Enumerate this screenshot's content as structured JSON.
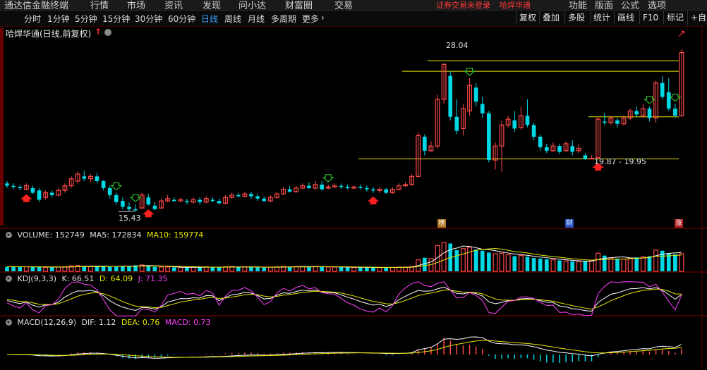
{
  "menu": {
    "app_title": "通达信金融终端",
    "items": [
      "行情",
      "市场",
      "资讯",
      "发现",
      "问小达",
      "财富圈",
      "交易"
    ],
    "warning": "证券交易未登录",
    "stock_link": "哈焊华通",
    "right_items": [
      "功能",
      "版面",
      "公式",
      "选项"
    ]
  },
  "toolbar": {
    "periods": [
      "分时",
      "1分钟",
      "5分钟",
      "15分钟",
      "30分钟",
      "60分钟",
      "日线",
      "周线",
      "月线",
      "多周期",
      "更多"
    ],
    "active_period": "日线",
    "right_buttons": [
      "复权",
      "叠加",
      "多股",
      "统计",
      "画线",
      "F10",
      "标记",
      "+自选"
    ]
  },
  "chart_header": {
    "title": "哈焊华通(日线,前复权)"
  },
  "annotations": {
    "high_label": "28.04",
    "low_label": "15.43",
    "range_label": "19.87 - 19.95"
  },
  "badges": {
    "bang": "榜",
    "cai": "财",
    "zhang": "涨"
  },
  "volume_header": {
    "label": "VOLUME: 152749",
    "ma5": "MA5: 172834",
    "ma10": "MA10: 159774"
  },
  "kdj_header": {
    "label": "KDJ(9,3,3)",
    "k": "K: 66.51",
    "d": "D: 64.09",
    "j": "J: 71.35"
  },
  "macd_header": {
    "label": "MACD(12,26,9)",
    "dif": "DIF: 1.12",
    "dea": "DEA: 0.76",
    "macd": "MACD: 0.73"
  },
  "colors": {
    "up": "#ff4a4a",
    "down": "#00d8e6",
    "ma_white": "#ffffff",
    "ma_yellow": "#e8e800",
    "kdj_j": "#ff40ff",
    "line_yellow": "#e6e600"
  },
  "chart_data": {
    "type": "candlestick",
    "price_range": [
      14.8,
      30.0
    ],
    "candles": [
      [
        17.8,
        17.6,
        18.0,
        17.4
      ],
      [
        17.6,
        17.5,
        17.8,
        17.3
      ],
      [
        17.5,
        17.4,
        17.7,
        17.2
      ],
      [
        17.3,
        17.6,
        17.8,
        17.2
      ],
      [
        17.4,
        17.0,
        17.6,
        16.9
      ],
      [
        17.2,
        16.4,
        17.4,
        16.2
      ],
      [
        16.6,
        17.0,
        17.2,
        16.4
      ],
      [
        17.0,
        16.8,
        17.2,
        16.6
      ],
      [
        16.8,
        17.2,
        17.4,
        16.7
      ],
      [
        17.2,
        17.6,
        17.8,
        17.0
      ],
      [
        17.6,
        18.2,
        18.4,
        17.4
      ],
      [
        18.0,
        18.6,
        18.8,
        17.8
      ],
      [
        18.4,
        18.2,
        18.9,
        18.0
      ],
      [
        18.2,
        18.4,
        18.6,
        17.9
      ],
      [
        18.4,
        18.0,
        18.7,
        17.8
      ],
      [
        18.0,
        17.4,
        18.1,
        17.2
      ],
      [
        17.4,
        16.8,
        17.6,
        16.5
      ],
      [
        16.8,
        16.2,
        17.0,
        16.0
      ],
      [
        16.3,
        15.8,
        16.6,
        15.6
      ],
      [
        15.8,
        15.6,
        16.2,
        15.4
      ],
      [
        15.6,
        15.5,
        16.0,
        15.43
      ],
      [
        15.7,
        16.8,
        17.0,
        15.6
      ],
      [
        16.6,
        16.0,
        16.9,
        15.9
      ],
      [
        15.9,
        15.6,
        16.2,
        15.5
      ],
      [
        15.7,
        16.3,
        16.5,
        15.6
      ],
      [
        16.3,
        16.5,
        16.8,
        16.2
      ],
      [
        16.4,
        16.3,
        16.6,
        16.2
      ],
      [
        16.3,
        16.4,
        16.6,
        16.2
      ],
      [
        16.3,
        16.2,
        16.5,
        16.0
      ],
      [
        16.2,
        16.4,
        16.6,
        16.1
      ],
      [
        16.4,
        16.2,
        16.6,
        16.0
      ],
      [
        16.2,
        16.5,
        16.7,
        16.1
      ],
      [
        16.4,
        16.3,
        16.6,
        16.2
      ],
      [
        16.3,
        16.1,
        16.5,
        16.0
      ],
      [
        16.1,
        16.6,
        16.8,
        16.0
      ],
      [
        16.6,
        16.8,
        17.0,
        16.5
      ],
      [
        16.8,
        16.7,
        17.0,
        16.6
      ],
      [
        16.7,
        16.9,
        17.1,
        16.6
      ],
      [
        16.9,
        16.7,
        17.1,
        16.5
      ],
      [
        16.7,
        16.5,
        16.9,
        16.3
      ],
      [
        16.5,
        16.3,
        16.7,
        16.2
      ],
      [
        16.3,
        16.6,
        16.8,
        16.2
      ],
      [
        16.6,
        16.9,
        17.1,
        16.5
      ],
      [
        16.9,
        17.3,
        17.5,
        16.8
      ],
      [
        17.3,
        17.1,
        17.6,
        17.0
      ],
      [
        17.1,
        17.4,
        17.6,
        17.0
      ],
      [
        17.4,
        17.6,
        17.8,
        17.3
      ],
      [
        17.6,
        17.4,
        17.9,
        17.3
      ],
      [
        17.4,
        17.7,
        18.0,
        17.3
      ],
      [
        17.7,
        17.3,
        18.0,
        17.2
      ],
      [
        17.4,
        17.5,
        17.7,
        17.3
      ],
      [
        17.5,
        17.6,
        17.8,
        17.4
      ],
      [
        17.6,
        17.5,
        17.8,
        17.3
      ],
      [
        17.5,
        17.4,
        17.7,
        17.3
      ],
      [
        17.4,
        17.5,
        17.6,
        17.3
      ],
      [
        17.5,
        17.4,
        17.7,
        17.3
      ],
      [
        17.4,
        17.3,
        17.6,
        17.1
      ],
      [
        17.3,
        17.2,
        17.5,
        17.0
      ],
      [
        17.2,
        17.3,
        17.5,
        17.0
      ],
      [
        17.3,
        17.0,
        17.4,
        16.9
      ],
      [
        17.0,
        17.3,
        17.5,
        16.9
      ],
      [
        17.3,
        17.6,
        17.8,
        17.2
      ],
      [
        17.6,
        17.7,
        17.9,
        17.5
      ],
      [
        17.7,
        18.4,
        18.6,
        17.6
      ],
      [
        18.4,
        21.9,
        22.2,
        18.3
      ],
      [
        21.8,
        20.6,
        22.0,
        20.2
      ],
      [
        20.6,
        21.0,
        21.4,
        20.5
      ],
      [
        21.0,
        25.0,
        25.4,
        20.8
      ],
      [
        25.0,
        28.0,
        28.04,
        24.6
      ],
      [
        27.0,
        23.5,
        27.4,
        23.2
      ],
      [
        23.5,
        22.3,
        25.0,
        22.0
      ],
      [
        22.5,
        24.2,
        24.6,
        21.9
      ],
      [
        24.0,
        26.2,
        26.8,
        23.6
      ],
      [
        26.0,
        24.8,
        26.4,
        24.4
      ],
      [
        24.6,
        23.8,
        25.2,
        23.4
      ],
      [
        23.8,
        19.8,
        24.0,
        19.6
      ],
      [
        19.8,
        21.0,
        21.3,
        19.0
      ],
      [
        21.0,
        22.8,
        23.2,
        18.8
      ],
      [
        22.8,
        23.3,
        23.6,
        22.6
      ],
      [
        23.2,
        22.5,
        24.0,
        22.2
      ],
      [
        22.6,
        23.6,
        24.4,
        22.4
      ],
      [
        23.6,
        22.8,
        25.0,
        22.6
      ],
      [
        22.8,
        21.8,
        23.0,
        21.5
      ],
      [
        21.8,
        20.9,
        22.0,
        20.6
      ],
      [
        20.9,
        20.6,
        21.2,
        20.4
      ],
      [
        20.6,
        21.0,
        21.3,
        20.5
      ],
      [
        21.0,
        20.5,
        21.2,
        20.3
      ],
      [
        20.6,
        21.2,
        21.4,
        20.5
      ],
      [
        21.0,
        20.5,
        21.5,
        20.2
      ],
      [
        20.6,
        20.8,
        21.2,
        20.4
      ],
      [
        20.2,
        19.9,
        20.4,
        19.8
      ],
      [
        19.9,
        19.95,
        20.2,
        19.87
      ],
      [
        20.0,
        23.3,
        23.5,
        19.9
      ],
      [
        23.1,
        23.0,
        23.8,
        22.8
      ],
      [
        23.0,
        23.4,
        23.6,
        22.8
      ],
      [
        23.2,
        22.9,
        23.4,
        22.6
      ],
      [
        22.9,
        23.4,
        23.6,
        22.8
      ],
      [
        23.4,
        24.0,
        24.2,
        23.2
      ],
      [
        24.0,
        23.7,
        24.4,
        23.5
      ],
      [
        23.6,
        24.2,
        24.6,
        23.4
      ],
      [
        24.2,
        23.4,
        24.4,
        23.1
      ],
      [
        23.4,
        26.4,
        26.6,
        23.0
      ],
      [
        26.4,
        25.2,
        27.0,
        25.0
      ],
      [
        25.6,
        24.2,
        26.8,
        24.0
      ],
      [
        24.2,
        23.6,
        24.6,
        23.4
      ],
      [
        23.6,
        29.0,
        29.3,
        23.5
      ]
    ],
    "volumes": [
      15,
      16,
      14,
      15,
      14,
      16,
      13,
      13,
      14,
      15,
      18,
      19,
      17,
      16,
      17,
      17,
      15,
      16,
      18,
      17,
      20,
      21,
      18,
      15,
      14,
      14,
      13,
      13,
      13,
      14,
      14,
      15,
      14,
      13,
      15,
      16,
      14,
      15,
      14,
      13,
      12,
      14,
      15,
      16,
      15,
      16,
      16,
      15,
      16,
      15,
      14,
      14,
      14,
      13,
      13,
      13,
      13,
      13,
      12,
      13,
      13,
      14,
      14,
      16,
      38,
      45,
      42,
      85,
      95,
      92,
      70,
      75,
      80,
      72,
      68,
      62,
      58,
      60,
      55,
      50,
      52,
      48,
      44,
      42,
      40,
      38,
      36,
      34,
      33,
      32,
      34,
      36,
      60,
      52,
      44,
      42,
      40,
      44,
      46,
      48,
      50,
      70,
      68,
      60,
      56,
      58
    ]
  }
}
